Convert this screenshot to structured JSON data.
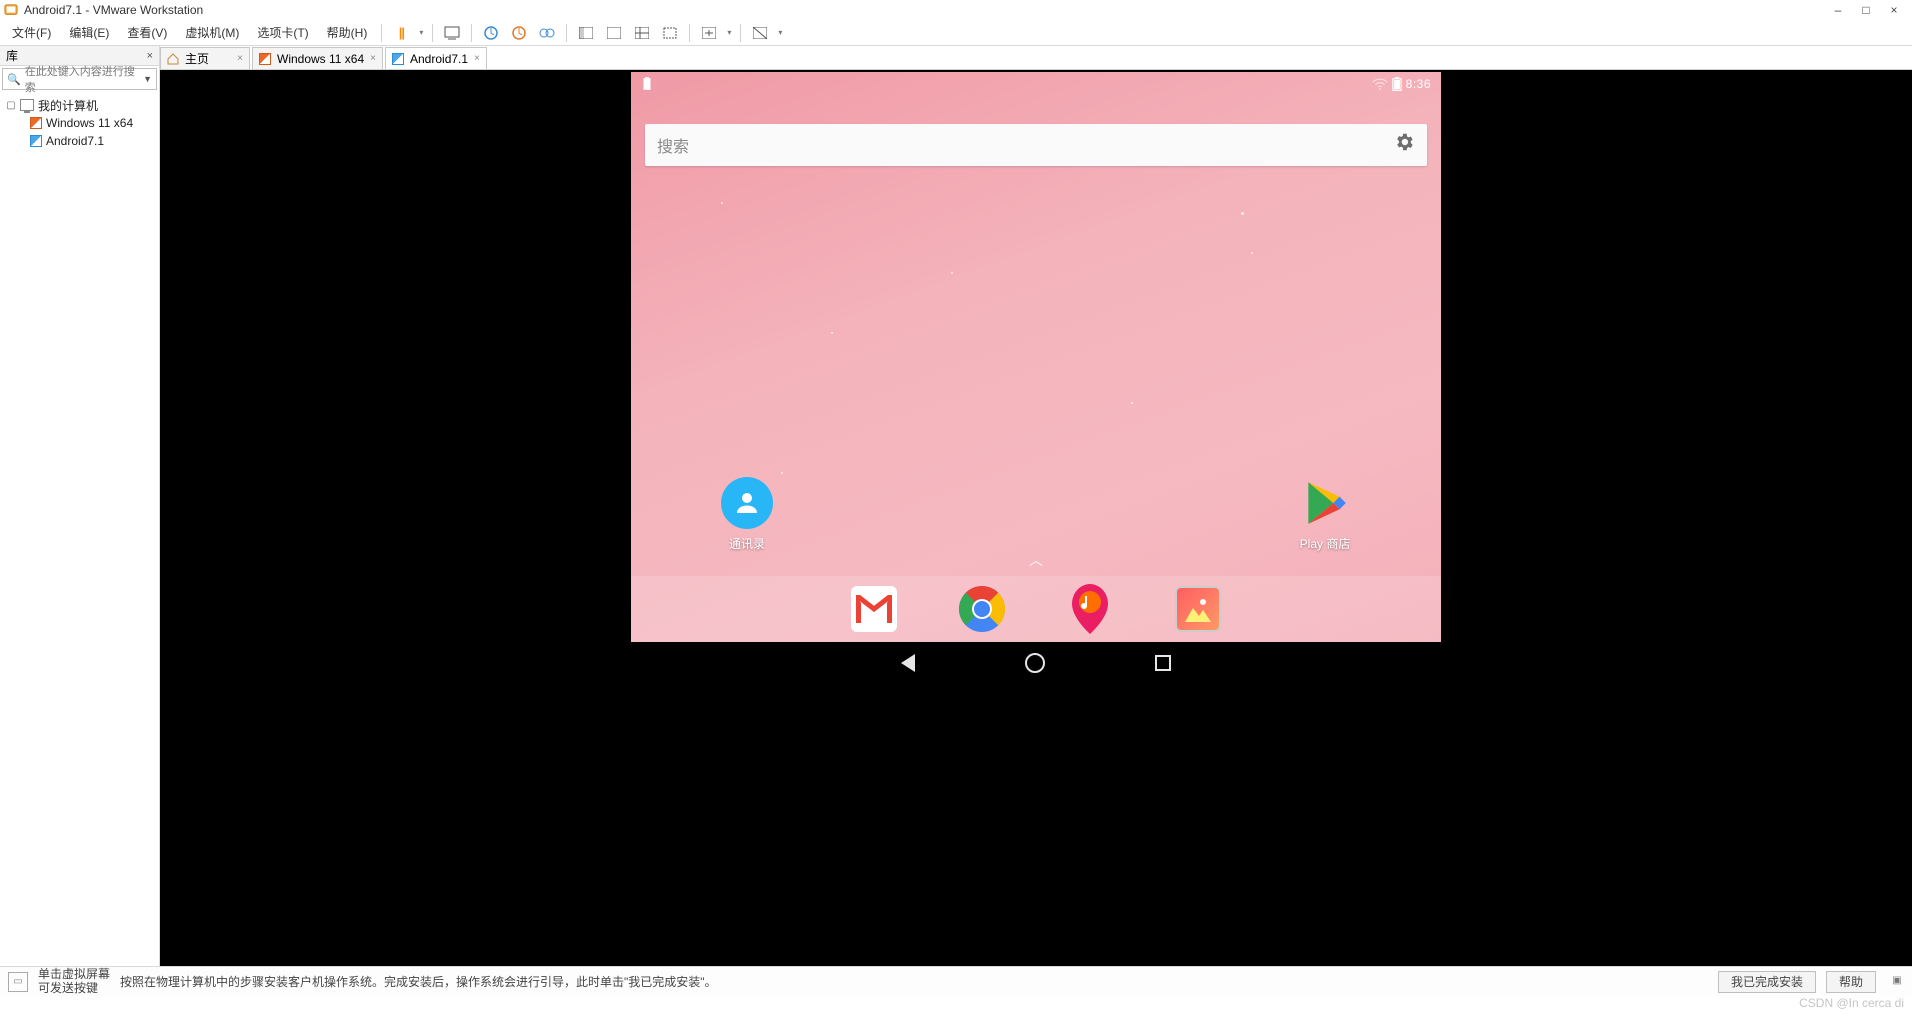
{
  "window": {
    "title": "Android7.1 - VMware Workstation",
    "minimize": "–",
    "maximize": "□",
    "close": "×"
  },
  "menu": {
    "items": [
      "文件(F)",
      "编辑(E)",
      "查看(V)",
      "虚拟机(M)",
      "选项卡(T)",
      "帮助(H)"
    ]
  },
  "sidebar": {
    "title": "库",
    "close": "×",
    "search_placeholder": "在此处键入内容进行搜索",
    "root": "我的计算机",
    "vms": [
      "Windows 11 x64",
      "Android7.1"
    ]
  },
  "tabs": [
    {
      "label": "主页"
    },
    {
      "label": "Windows 11 x64"
    },
    {
      "label": "Android7.1",
      "active": true
    }
  ],
  "android": {
    "time": "8:36",
    "search_placeholder": "搜索",
    "apps": {
      "contacts": "通讯录",
      "play_store": "Play 商店"
    }
  },
  "hint": {
    "lead": "单击虚拟屏幕\n可发送按键",
    "message": "按照在物理计算机中的步骤安装客户机操作系统。完成安装后，操作系统会进行引导，此时单击\"我已完成安装\"。",
    "done_btn": "我已完成安装",
    "help_btn": "帮助"
  },
  "watermark": "CSDN @In cerca di"
}
